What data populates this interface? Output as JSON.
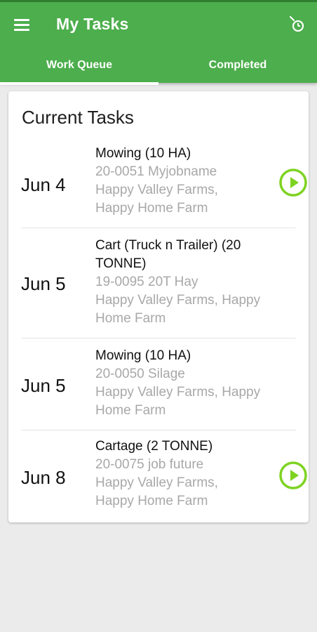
{
  "header": {
    "title": "My Tasks",
    "tabs": [
      {
        "label": "Work Queue",
        "active": true
      },
      {
        "label": "Completed",
        "active": false
      }
    ]
  },
  "card": {
    "title": "Current Tasks"
  },
  "tasks": [
    {
      "date": "Jun 4",
      "name": "Mowing (10 HA)",
      "job": "20-0051 Myjobname",
      "place_line1": "Happy Valley Farms,",
      "place_line2": "Happy Home Farm",
      "play_visible": true
    },
    {
      "date": "Jun 5",
      "name_line1": "Cart (Truck n Trailer) (20",
      "name_line2": "TONNE)",
      "job": "19-0095 20T Hay",
      "place_line1": "Happy Valley Farms, Happy",
      "place_line2": "Home Farm",
      "play_visible": false
    },
    {
      "date": "Jun 5",
      "name": "Mowing (10 HA)",
      "job": "20-0050 Silage",
      "place_line1": "Happy Valley Farms, Happy",
      "place_line2": "Home Farm",
      "play_visible": false
    },
    {
      "date": "Jun 8",
      "name": "Cartage (2 TONNE)",
      "job": "20-0075 job future",
      "place_line1": "Happy Valley Farms,",
      "place_line2": "Happy Home Farm",
      "play_visible": true
    }
  ],
  "icons": {
    "menu": "hamburger-menu-icon",
    "timer": "timer-icon",
    "play": "play-circle-icon"
  },
  "colors": {
    "primary": "#4cae4c",
    "accent": "#7ed321",
    "background": "#ebebeb"
  }
}
